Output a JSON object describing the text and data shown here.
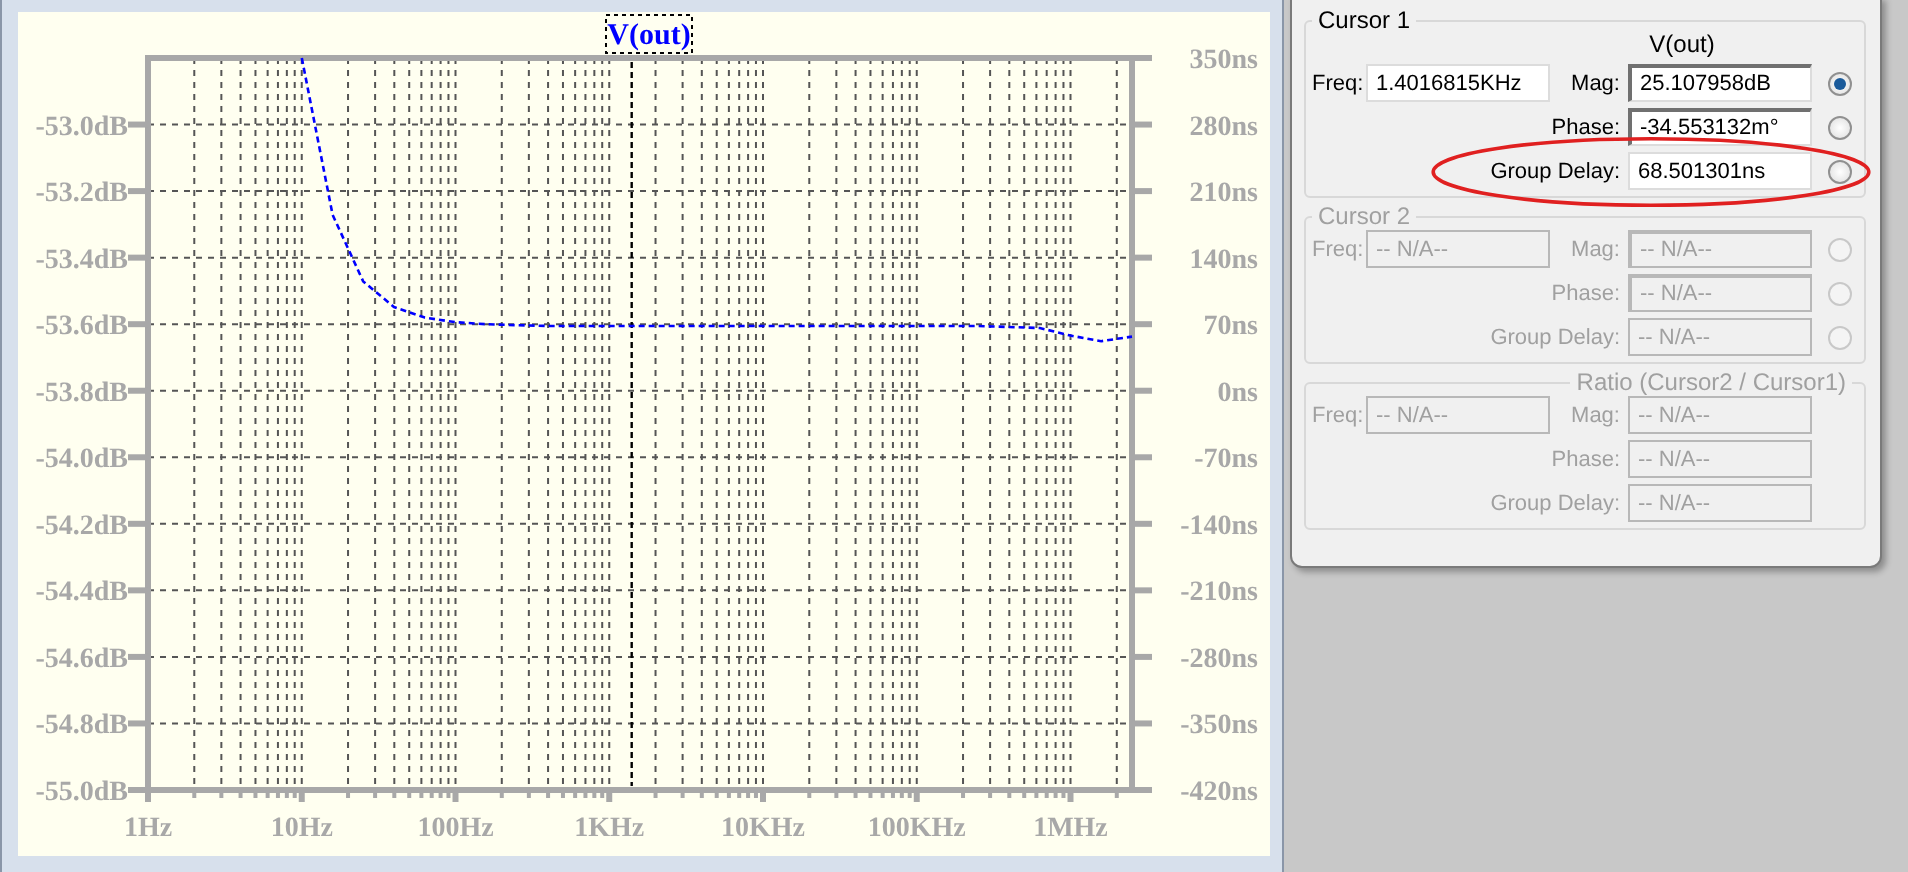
{
  "plot": {
    "left_axis_labels": [
      "-53.0dB",
      "-53.2dB",
      "-53.4dB",
      "-53.6dB",
      "-53.8dB",
      "-54.0dB",
      "-54.2dB",
      "-54.4dB",
      "-54.6dB",
      "-54.8dB",
      "-55.0dB"
    ],
    "chart_data": {
      "type": "line",
      "grid": true,
      "ylim": [
        -420,
        350
      ],
      "categories": [
        "1Hz",
        null,
        null,
        null,
        null,
        "10Hz",
        null,
        null,
        null,
        null,
        "100Hz",
        null,
        null,
        null,
        null,
        "1KHz",
        null,
        null,
        null,
        null,
        "10KHz",
        null,
        null,
        null,
        null,
        "100KHz",
        null,
        null,
        null,
        null,
        "1MHz",
        null,
        null
      ],
      "yticks": [
        {
          "value": 350,
          "label": "350ns"
        },
        {
          "value": 280,
          "label": "280ns"
        },
        {
          "value": 210,
          "label": "210ns"
        },
        {
          "value": 140,
          "label": "140ns"
        },
        {
          "value": 70,
          "label": "70ns"
        },
        {
          "value": 0,
          "label": "0ns"
        },
        {
          "value": -70,
          "label": "-70ns"
        },
        {
          "value": -140,
          "label": "-140ns"
        },
        {
          "value": -210,
          "label": "-210ns"
        },
        {
          "value": -280,
          "label": "-280ns"
        },
        {
          "value": -350,
          "label": "-350ns"
        },
        {
          "value": -420,
          "label": "-420ns"
        }
      ],
      "series": [
        {
          "name": "V(out)",
          "color": "#0000ff",
          "line_style": "dashed",
          "values": [
            null,
            null,
            null,
            null,
            null,
            350,
            185,
            115,
            88,
            77,
            72,
            70,
            69,
            68,
            68,
            68,
            68,
            68,
            68,
            68,
            68,
            68,
            68,
            68,
            68,
            68,
            68,
            68,
            67,
            66,
            58,
            52,
            57
          ]
        }
      ]
    }
  },
  "cursor_panel": {
    "groups": [
      {
        "kind": "cursor",
        "title": "Cursor 1",
        "subtitle": "V(out)",
        "disabled": false,
        "freq_label": "Freq:",
        "freq": "1.4016815KHz",
        "rows": [
          {
            "label": "Mag:",
            "value": "25.107958dB",
            "selected": true,
            "highlighted": false
          },
          {
            "label": "Phase:",
            "value": "-34.553132m°",
            "selected": false,
            "highlighted": false
          },
          {
            "label": "Group Delay:",
            "value": "68.501301ns",
            "selected": false,
            "highlighted": true
          }
        ]
      },
      {
        "kind": "cursor",
        "title": "Cursor 2",
        "disabled": true,
        "freq_label": "Freq:",
        "freq": "-- N/A--",
        "rows": [
          {
            "label": "Mag:",
            "value": "-- N/A--",
            "selected": false,
            "highlighted": false
          },
          {
            "label": "Phase:",
            "value": "-- N/A--",
            "selected": false,
            "highlighted": false
          },
          {
            "label": "Group Delay:",
            "value": "-- N/A--",
            "selected": false,
            "highlighted": false
          }
        ]
      },
      {
        "kind": "ratio",
        "title": "Ratio (Cursor2 / Cursor1)",
        "disabled": true,
        "freq_label": "Freq:",
        "freq": "-- N/A--",
        "rows": [
          {
            "label": "Mag:",
            "value": "-- N/A--",
            "highlighted": false
          },
          {
            "label": "Phase:",
            "value": "-- N/A--",
            "highlighted": false
          },
          {
            "label": "Group Delay:",
            "value": "-- N/A--",
            "highlighted": false
          }
        ]
      }
    ]
  }
}
